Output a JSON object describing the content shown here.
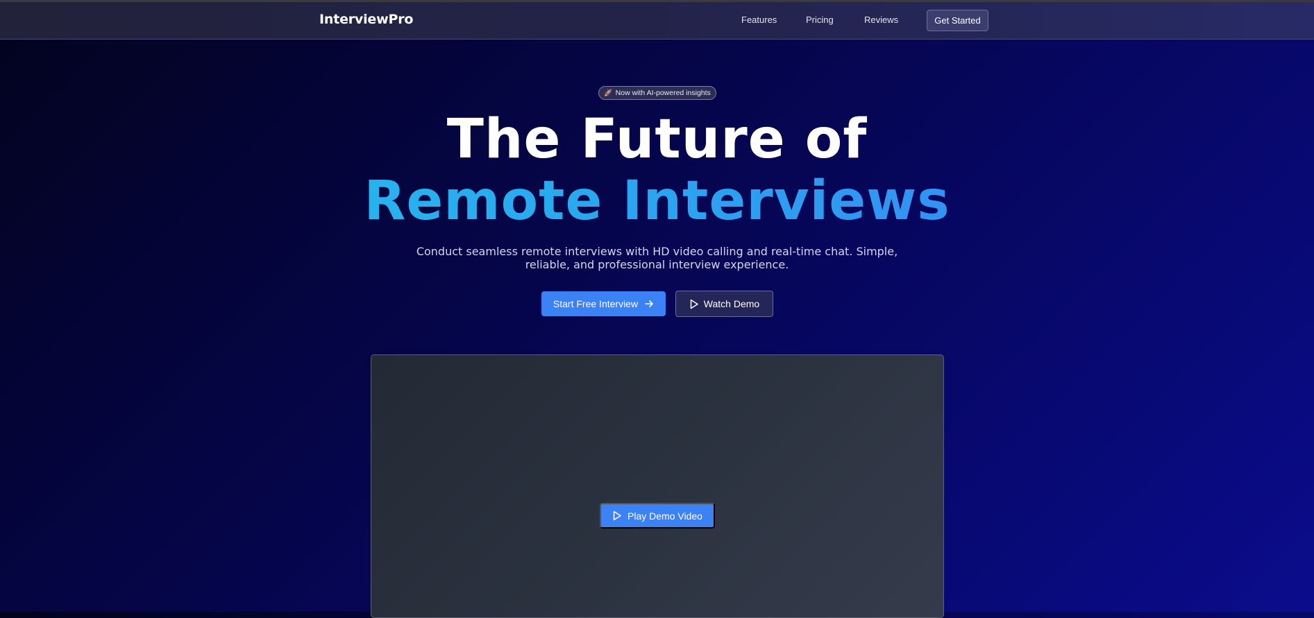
{
  "navbar": {
    "brand": "InterviewPro",
    "links": [
      "Features",
      "Pricing",
      "Reviews"
    ],
    "cta_label": "Get Started"
  },
  "hero": {
    "badge_icon": "rocket-icon",
    "badge_emoji": "🚀",
    "badge_text": "Now with AI-powered insights",
    "headline_line1": "The Future of",
    "headline_line2": "Remote Interviews",
    "subtitle": "Conduct seamless remote interviews with HD video calling and real-time chat. Simple, reliable, and professional interview experience.",
    "primary_button": {
      "label": "Start Free Interview",
      "icon": "arrow-right-icon"
    },
    "secondary_button": {
      "label": "Watch Demo",
      "icon": "play-icon"
    }
  },
  "demo": {
    "play_button": {
      "label": "Play Demo Video",
      "icon": "play-icon"
    }
  },
  "colors": {
    "accent": "#3b82f6",
    "gradient_text_start": "#22c3ea",
    "gradient_text_end": "#3a7bf5",
    "background_dark": "#03031e",
    "background_light": "#0a0c8c"
  }
}
